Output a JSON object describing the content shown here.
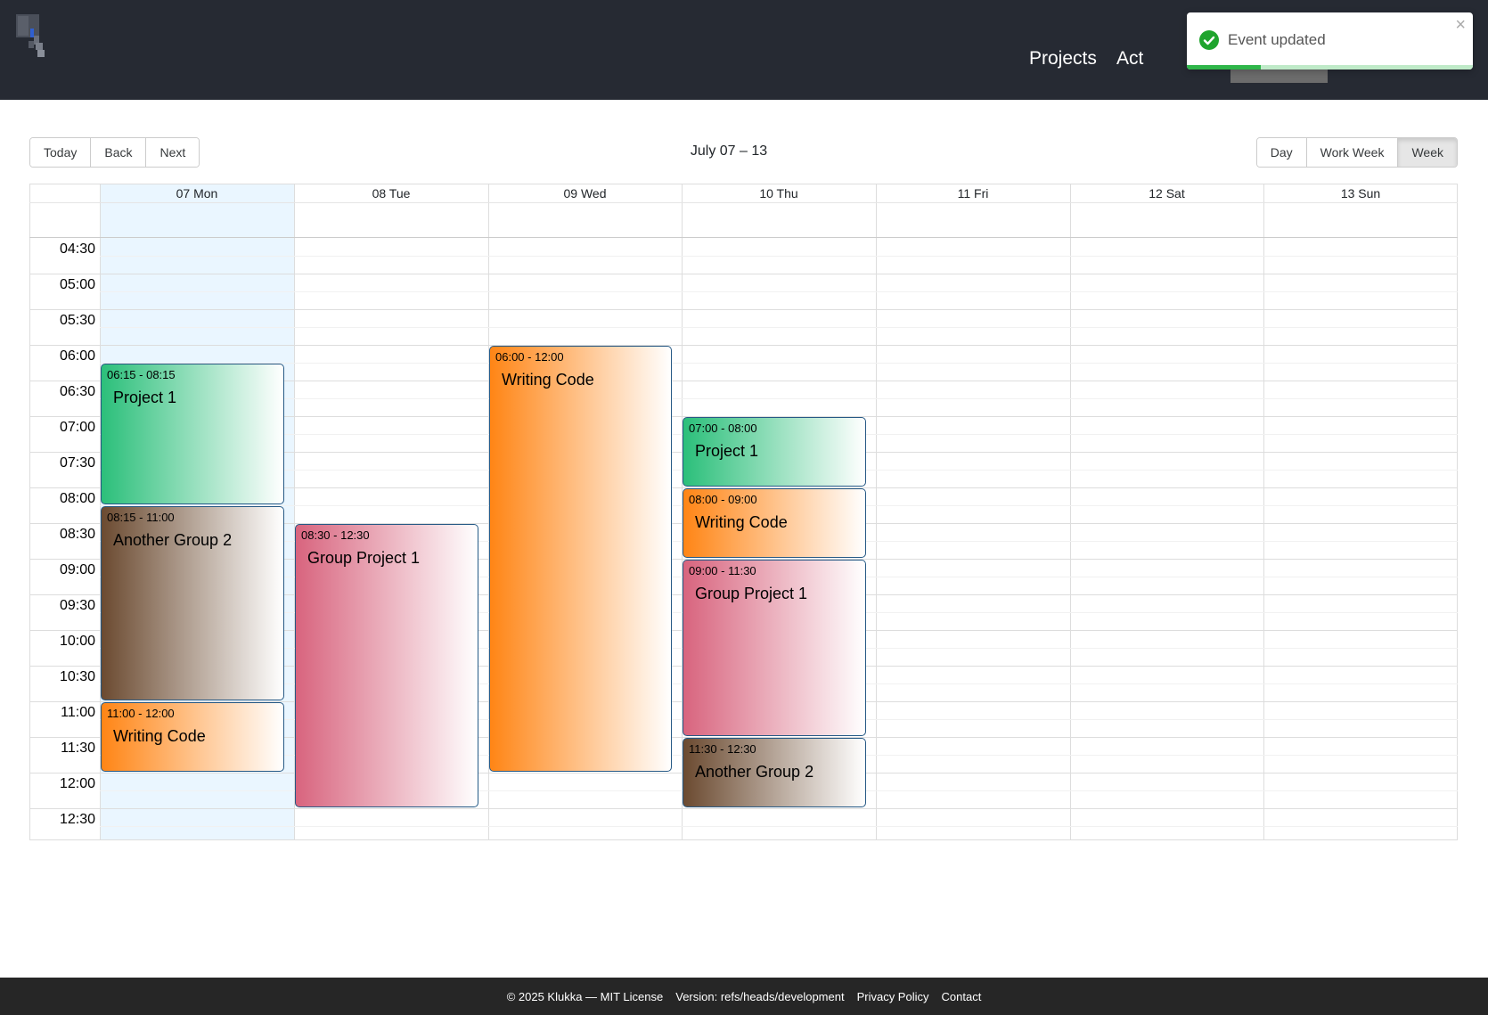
{
  "nav": {
    "links": [
      "Projects",
      "Act"
    ]
  },
  "toast": {
    "message": "Event updated",
    "close": "×",
    "progress": 0.26
  },
  "toolbar": {
    "nav_buttons": [
      "Today",
      "Back",
      "Next"
    ],
    "label": "July 07 – 13",
    "view_buttons": [
      "Day",
      "Work Week",
      "Week"
    ],
    "active_view": "Week"
  },
  "calendar": {
    "days": [
      "07 Mon",
      "08 Tue",
      "09 Wed",
      "10 Thu",
      "11 Fri",
      "12 Sat",
      "13 Sun"
    ],
    "today_index": 0,
    "times": [
      "04:30",
      "05:00",
      "05:30",
      "06:00",
      "06:30",
      "07:00",
      "07:30",
      "08:00",
      "08:30",
      "09:00",
      "09:30",
      "10:00",
      "10:30",
      "11:00",
      "11:30",
      "12:00",
      "12:30"
    ],
    "events": [
      {
        "day": 0,
        "start": "06:15",
        "end": "08:15",
        "time": "06:15 - 08:15",
        "title": "Project 1",
        "group": "project1"
      },
      {
        "day": 0,
        "start": "08:15",
        "end": "11:00",
        "time": "08:15 - 11:00",
        "title": "Another Group 2",
        "group": "group2"
      },
      {
        "day": 0,
        "start": "11:00",
        "end": "12:00",
        "time": "11:00 - 12:00",
        "title": "Writing Code",
        "group": "code"
      },
      {
        "day": 1,
        "start": "08:30",
        "end": "12:30",
        "time": "08:30 - 12:30",
        "title": "Group Project 1",
        "group": "gproject1"
      },
      {
        "day": 2,
        "start": "06:00",
        "end": "12:00",
        "time": "06:00 - 12:00",
        "title": "Writing Code",
        "group": "code"
      },
      {
        "day": 3,
        "start": "07:00",
        "end": "08:00",
        "time": "07:00 - 08:00",
        "title": "Project 1",
        "group": "project1"
      },
      {
        "day": 3,
        "start": "08:00",
        "end": "09:00",
        "time": "08:00 - 09:00",
        "title": "Writing Code",
        "group": "code"
      },
      {
        "day": 3,
        "start": "09:00",
        "end": "11:30",
        "time": "09:00 - 11:30",
        "title": "Group Project 1",
        "group": "gproject1"
      },
      {
        "day": 3,
        "start": "11:30",
        "end": "12:30",
        "time": "11:30 - 12:30",
        "title": "Another Group 2",
        "group": "group2"
      }
    ],
    "colors": {
      "project1": "#2bbf7a",
      "group2": "#6b4a30",
      "code": "#ff8515",
      "gproject1": "#d8647e"
    }
  },
  "footer": {
    "copyright": "© 2025 Klukka — MIT License",
    "version": "Version: refs/heads/development",
    "privacy": "Privacy Policy",
    "contact": "Contact"
  }
}
